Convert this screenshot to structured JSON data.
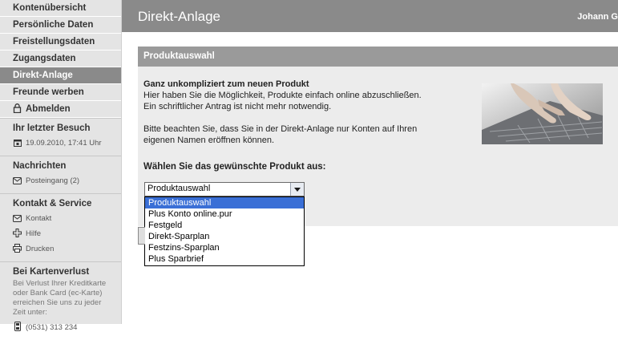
{
  "sidebar": {
    "items": [
      {
        "label": "Kontenübersicht",
        "active": false
      },
      {
        "label": "Persönliche Daten",
        "active": false
      },
      {
        "label": "Freistellungsdaten",
        "active": false
      },
      {
        "label": "Zugangsdaten",
        "active": false
      },
      {
        "label": "Direkt-Anlage",
        "active": true
      },
      {
        "label": "Freunde werben",
        "active": false
      },
      {
        "label": "Abmelden",
        "active": false,
        "icon": "lock-icon"
      }
    ],
    "last_visit": {
      "title": "Ihr letzter Besuch",
      "value": "19.09.2010, 17:41 Uhr",
      "icon": "calendar-icon"
    },
    "messages": {
      "title": "Nachrichten",
      "inbox": "Posteingang (2)",
      "icon": "envelope-icon"
    },
    "contact": {
      "title": "Kontakt & Service",
      "contact": "Kontakt",
      "help": "Hilfe",
      "print": "Drucken"
    },
    "card_loss": {
      "title": "Bei Kartenverlust",
      "text": "Bei Verlust Ihrer Kreditkarte oder Bank Card (ec-Karte) erreichen Sie uns zu jeder Zeit unter:",
      "phone": "(0531) 313 234",
      "icon": "phone-icon"
    }
  },
  "header": {
    "title": "Direkt-Anlage",
    "user": "Johann G"
  },
  "panel": {
    "title": "Produktauswahl",
    "heading": "Ganz unkompliziert zum neuen Produkt",
    "line1": "Hier haben Sie die Möglichkeit, Produkte einfach online abzuschließen.",
    "line2": "Ein schriftlicher Antrag ist nicht mehr notwendig.",
    "line3": "Bitte beachten Sie, dass Sie in der Direkt-Anlage nur Konten auf Ihren",
    "line4": "eigenen Namen eröffnen können.",
    "choose_label": "Wählen Sie das gewünschte Produkt aus:",
    "image": "hands-on-keyboard-photo"
  },
  "select": {
    "value": "Produktauswahl",
    "options": [
      "Produktauswahl",
      "Plus Konto online.pur",
      "Festgeld",
      "Direkt-Sparplan",
      "Festzins-Sparplan",
      "Plus Sparbrief"
    ],
    "highlighted_index": 0
  },
  "colors": {
    "header": "#8a8a8a",
    "sidebar": "#e4e4e4",
    "highlight": "#3a6fd6"
  }
}
